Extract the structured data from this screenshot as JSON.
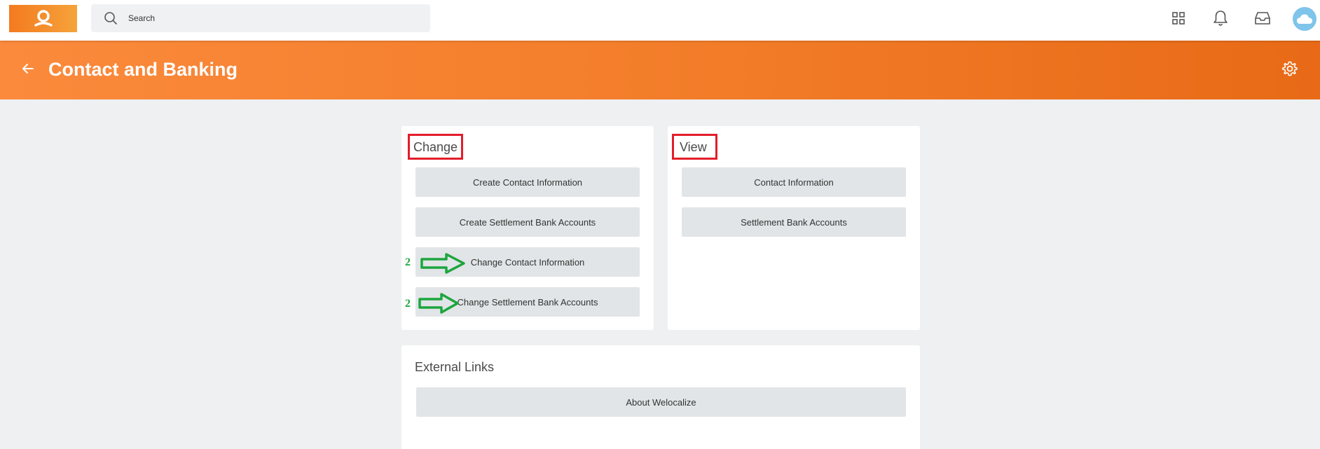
{
  "topbar": {
    "search_placeholder": "Search",
    "icons": [
      "apps-grid-icon",
      "notification-bell-icon",
      "inbox-icon",
      "cloud-avatar"
    ]
  },
  "header": {
    "title": "Contact and Banking"
  },
  "change_card": {
    "title": "Change",
    "buttons": [
      "Create Contact Information",
      "Create Settlement Bank Accounts",
      "Change Contact Information",
      "Change Settlement Bank Accounts"
    ]
  },
  "view_card": {
    "title": "View",
    "buttons": [
      "Contact Information",
      "Settlement Bank Accounts"
    ]
  },
  "external_card": {
    "title": "External Links",
    "buttons": [
      "About Welocalize"
    ]
  },
  "annotations": {
    "marker_1": "2",
    "marker_2": "2"
  },
  "colors": {
    "brand_orange": "#f47a20",
    "highlight_red": "#e21d2a",
    "annotation_green": "#1da53e",
    "avatar_blue": "#7fc4ea"
  }
}
